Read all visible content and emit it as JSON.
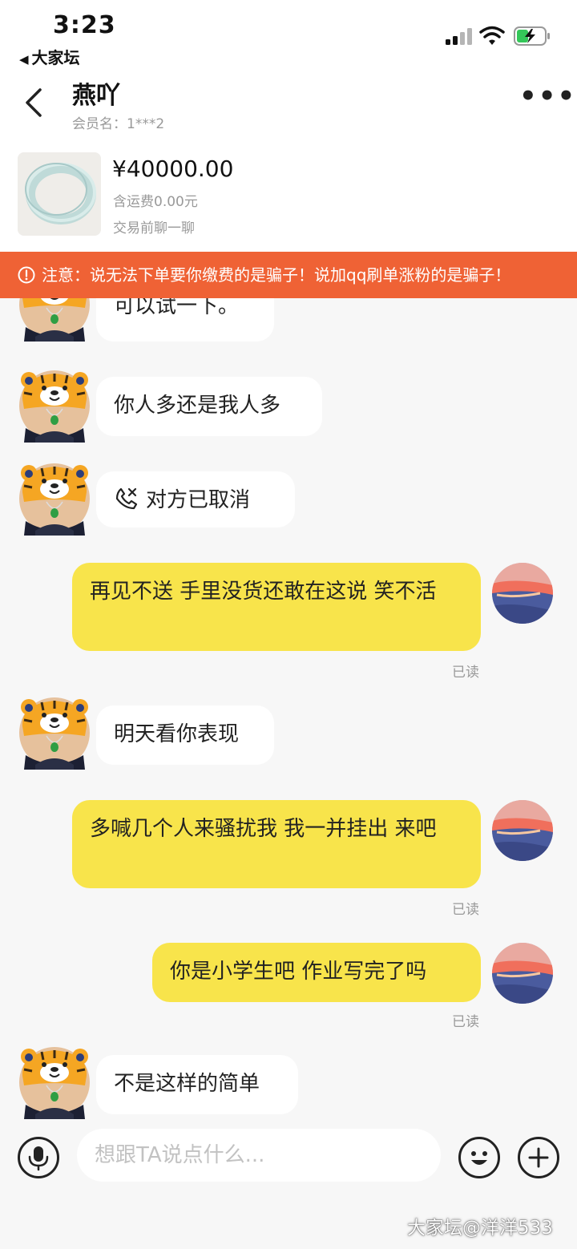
{
  "status_bar": {
    "time": "3:23",
    "back_app": "大家坛",
    "back_app_icon": "back-triangle-icon",
    "signal_icon": "cellular-signal-icon",
    "wifi_icon": "wifi-icon",
    "battery_icon": "battery-charging-icon"
  },
  "header": {
    "title": "燕吖",
    "subtitle": "会员名：1***2",
    "back_icon": "chevron-left-icon",
    "more_icon": "more-dots-icon",
    "more_label": "•••"
  },
  "product": {
    "price": "¥40000.00",
    "shipping": "含运费0.00元",
    "cta": "交易前聊一聊",
    "image_icon": "jade-bangle-photo"
  },
  "warning": {
    "text": "注意：说无法下单要你缴费的是骗子！说加qq刷单涨粉的是骗子！",
    "icon": "alert-circle-icon",
    "color": "#ef6235"
  },
  "messages": [
    {
      "side": "in",
      "text": "可以试一下。"
    },
    {
      "side": "in",
      "text": "你人多还是我人多"
    },
    {
      "side": "in",
      "type": "call",
      "text": "对方已取消",
      "icon": "phone-cancel-icon"
    },
    {
      "side": "out",
      "text": "再见不送 手里没货还敢在这说 笑不活",
      "status": "已读"
    },
    {
      "side": "in",
      "text": "明天看你表现"
    },
    {
      "side": "out",
      "text": "多喊几个人来骚扰我 我一并挂出 来吧",
      "status": "已读"
    },
    {
      "side": "out",
      "text": "你是小学生吧 作业写完了吗",
      "status": "已读"
    },
    {
      "side": "in",
      "text": "不是这样的简单"
    }
  ],
  "input_bar": {
    "placeholder": "想跟TA说点什么...",
    "mic_icon": "microphone-icon",
    "emoji_icon": "emoji-smile-icon",
    "plus_icon": "plus-icon"
  },
  "watermark": "大家坛@洋洋533",
  "colors": {
    "outgoing_bubble": "#f8e44b",
    "incoming_bubble": "#ffffff",
    "background": "#f7f7f7"
  }
}
